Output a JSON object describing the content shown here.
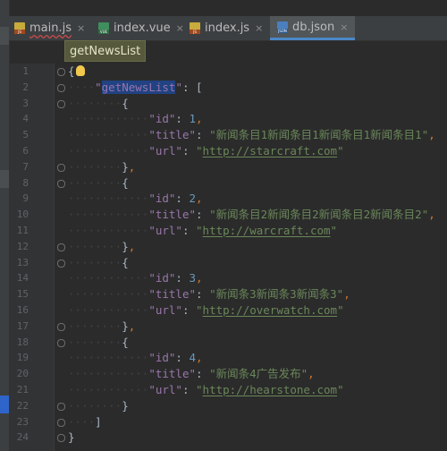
{
  "tabs": [
    {
      "label": "main.js",
      "icon": "js-file-icon",
      "badge": "JS",
      "active": false
    },
    {
      "label": "index.vue",
      "icon": "vue-file-icon",
      "badge": "VUE",
      "active": false
    },
    {
      "label": "index.js",
      "icon": "js-file-icon",
      "badge": "JS",
      "active": false
    },
    {
      "label": "db.json",
      "icon": "json-file-icon",
      "badge": "JSON",
      "active": true
    }
  ],
  "close_glyph": "×",
  "tooltip": "getNewsList",
  "line_numbers": [
    "1",
    "2",
    "3",
    "4",
    "5",
    "6",
    "7",
    "8",
    "9",
    "10",
    "11",
    "12",
    "13",
    "14",
    "15",
    "16",
    "17",
    "18",
    "19",
    "20",
    "21",
    "22",
    "23",
    "24"
  ],
  "code": {
    "open_brace": "{",
    "root_key": "getNewsList",
    "items": [
      {
        "id": "1",
        "title": "新闻条目1新闻条目1新闻条目1新闻条目1",
        "url": "http://starcraft.com"
      },
      {
        "id": "2",
        "title": "新闻条目2新闻条目2新闻条目2新闻条目2",
        "url": "http://warcraft.com"
      },
      {
        "id": "3",
        "title": "新闻条3新闻条3新闻条3",
        "url": "http://overwatch.com"
      },
      {
        "id": "4",
        "title": "新闻条4广告发布",
        "url": "http://hearstone.com"
      }
    ],
    "close_bracket": "]",
    "close_brace": "}"
  },
  "colors": {
    "background": "#2b2b2b",
    "key": "#9876aa",
    "string": "#6a8759",
    "number": "#6897bb",
    "punct": "#cc7832",
    "selection": "#214283",
    "active_tab_underline": "#4a88c7"
  }
}
